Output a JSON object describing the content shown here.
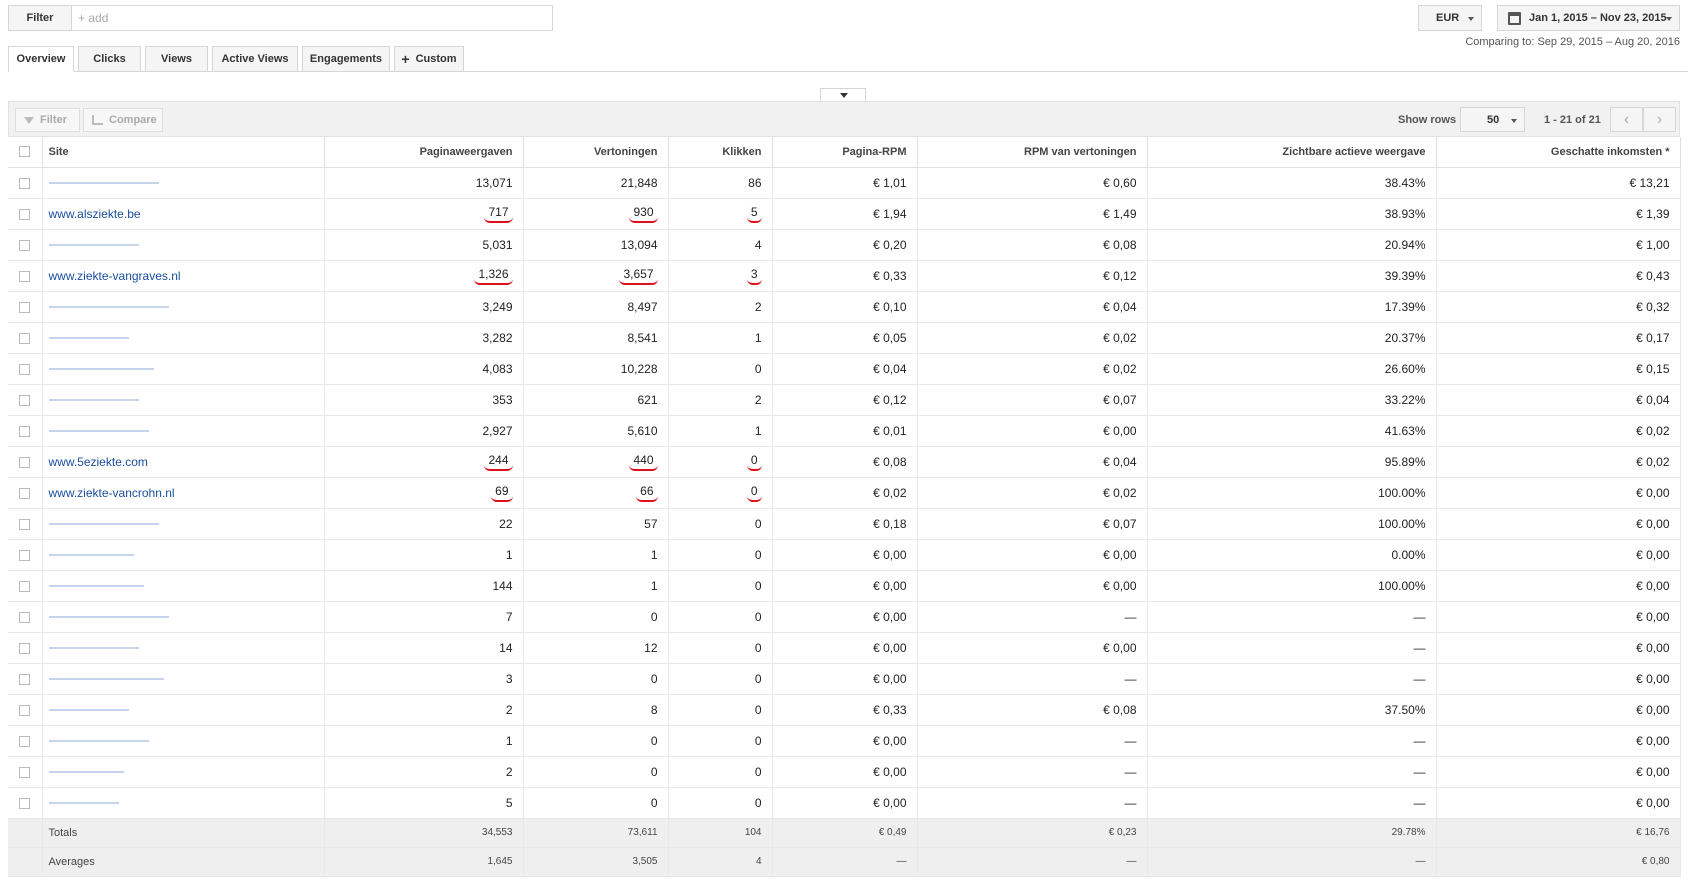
{
  "filter": {
    "label": "Filter",
    "placeholder": "+ add"
  },
  "currency": {
    "label": "EUR"
  },
  "daterange": {
    "label": "Jan 1, 2015 – Nov 23, 2015",
    "comparing": "Comparing to: Sep 29, 2015 – Aug 20, 2016"
  },
  "tabs": [
    {
      "label": "Overview",
      "active": true
    },
    {
      "label": "Clicks"
    },
    {
      "label": "Views"
    },
    {
      "label": "Active Views"
    },
    {
      "label": "Engagements"
    },
    {
      "label": "Custom"
    }
  ],
  "toolbar": {
    "filter_label": "Filter",
    "compare_label": "Compare",
    "show_rows_label": "Show rows",
    "rows_value": "50",
    "pager_text": "1 - 21 of 21"
  },
  "columns": [
    "Site",
    "Paginaweergaven",
    "Vertoningen",
    "Klikken",
    "Pagina-RPM",
    "RPM van vertoningen",
    "Zichtbare actieve weergave",
    "Geschatte inkomsten *"
  ],
  "rows": [
    {
      "site": "",
      "c1": "13,071",
      "c2": "21,848",
      "c3": "86",
      "c4": "€ 1,01",
      "c5": "€ 0,60",
      "c6": "38.43%",
      "c7": "€ 13,21"
    },
    {
      "site": "www.alsziekte.be",
      "c1": "717",
      "c2": "930",
      "c3": "5",
      "c4": "€ 1,94",
      "c5": "€ 1,49",
      "c6": "38.93%",
      "c7": "€ 1,39",
      "marked": true
    },
    {
      "site": "",
      "c1": "5,031",
      "c2": "13,094",
      "c3": "4",
      "c4": "€ 0,20",
      "c5": "€ 0,08",
      "c6": "20.94%",
      "c7": "€ 1,00"
    },
    {
      "site": "www.ziekte-vangraves.nl",
      "c1": "1,326",
      "c2": "3,657",
      "c3": "3",
      "c4": "€ 0,33",
      "c5": "€ 0,12",
      "c6": "39.39%",
      "c7": "€ 0,43",
      "marked": true
    },
    {
      "site": "",
      "c1": "3,249",
      "c2": "8,497",
      "c3": "2",
      "c4": "€ 0,10",
      "c5": "€ 0,04",
      "c6": "17.39%",
      "c7": "€ 0,32"
    },
    {
      "site": "",
      "c1": "3,282",
      "c2": "8,541",
      "c3": "1",
      "c4": "€ 0,05",
      "c5": "€ 0,02",
      "c6": "20.37%",
      "c7": "€ 0,17"
    },
    {
      "site": "",
      "c1": "4,083",
      "c2": "10,228",
      "c3": "0",
      "c4": "€ 0,04",
      "c5": "€ 0,02",
      "c6": "26.60%",
      "c7": "€ 0,15"
    },
    {
      "site": "",
      "c1": "353",
      "c2": "621",
      "c3": "2",
      "c4": "€ 0,12",
      "c5": "€ 0,07",
      "c6": "33.22%",
      "c7": "€ 0,04"
    },
    {
      "site": "",
      "c1": "2,927",
      "c2": "5,610",
      "c3": "1",
      "c4": "€ 0,01",
      "c5": "€ 0,00",
      "c6": "41.63%",
      "c7": "€ 0,02"
    },
    {
      "site": "www.5eziekte.com",
      "c1": "244",
      "c2": "440",
      "c3": "0",
      "c4": "€ 0,08",
      "c5": "€ 0,04",
      "c6": "95.89%",
      "c7": "€ 0,02",
      "marked": true
    },
    {
      "site": "www.ziekte-vancrohn.nl",
      "c1": "69",
      "c2": "66",
      "c3": "0",
      "c4": "€ 0,02",
      "c5": "€ 0,02",
      "c6": "100.00%",
      "c7": "€ 0,00",
      "marked": true
    },
    {
      "site": "",
      "c1": "22",
      "c2": "57",
      "c3": "0",
      "c4": "€ 0,18",
      "c5": "€ 0,07",
      "c6": "100.00%",
      "c7": "€ 0,00"
    },
    {
      "site": "",
      "c1": "1",
      "c2": "1",
      "c3": "0",
      "c4": "€ 0,00",
      "c5": "€ 0,00",
      "c6": "0.00%",
      "c7": "€ 0,00"
    },
    {
      "site": "",
      "c1": "144",
      "c2": "1",
      "c3": "0",
      "c4": "€ 0,00",
      "c5": "€ 0,00",
      "c6": "100.00%",
      "c7": "€ 0,00"
    },
    {
      "site": "",
      "c1": "7",
      "c2": "0",
      "c3": "0",
      "c4": "€ 0,00",
      "c5": "—",
      "c6": "—",
      "c7": "€ 0,00"
    },
    {
      "site": "",
      "c1": "14",
      "c2": "12",
      "c3": "0",
      "c4": "€ 0,00",
      "c5": "€ 0,00",
      "c6": "—",
      "c7": "€ 0,00"
    },
    {
      "site": "",
      "c1": "3",
      "c2": "0",
      "c3": "0",
      "c4": "€ 0,00",
      "c5": "—",
      "c6": "—",
      "c7": "€ 0,00"
    },
    {
      "site": "",
      "c1": "2",
      "c2": "8",
      "c3": "0",
      "c4": "€ 0,33",
      "c5": "€ 0,08",
      "c6": "37.50%",
      "c7": "€ 0,00"
    },
    {
      "site": "",
      "c1": "1",
      "c2": "0",
      "c3": "0",
      "c4": "€ 0,00",
      "c5": "—",
      "c6": "—",
      "c7": "€ 0,00"
    },
    {
      "site": "",
      "c1": "2",
      "c2": "0",
      "c3": "0",
      "c4": "€ 0,00",
      "c5": "—",
      "c6": "—",
      "c7": "€ 0,00"
    },
    {
      "site": "",
      "c1": "5",
      "c2": "0",
      "c3": "0",
      "c4": "€ 0,00",
      "c5": "—",
      "c6": "—",
      "c7": "€ 0,00"
    }
  ],
  "totals": {
    "site": "Totals",
    "c1": "34,553",
    "c2": "73,611",
    "c3": "104",
    "c4": "€ 0,49",
    "c5": "€ 0,23",
    "c6": "29.78%",
    "c7": "€ 16,76"
  },
  "averages": {
    "site": "Averages",
    "c1": "1,645",
    "c2": "3,505",
    "c3": "4",
    "c4": "—",
    "c5": "—",
    "c6": "—",
    "c7": "€ 0,80"
  },
  "colors": {
    "link": "#1a4fa0",
    "annotation": "#e0101a"
  }
}
